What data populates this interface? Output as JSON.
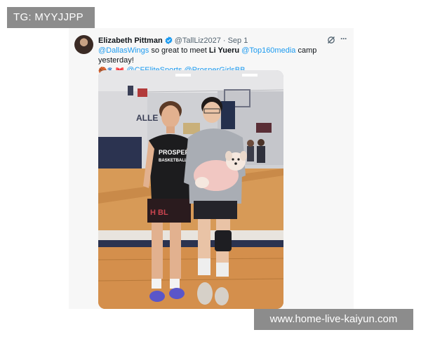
{
  "watermarks": {
    "top": "TG: MYYJJPP",
    "bottom": "www.home-live-kaiyun.com"
  },
  "tweet": {
    "author_name": "Elizabeth Pittman",
    "handle": "@TallLiz2027",
    "separator": "·",
    "date": "Sep 1",
    "line1": [
      {
        "text": "@DallasWings",
        "style": "mention"
      },
      {
        "text": " so great to meet ",
        "style": "plain"
      },
      {
        "text": "Li Yueru",
        "style": "bold"
      },
      {
        "text": " ",
        "style": "plain"
      },
      {
        "text": "@Top160media",
        "style": "mention"
      },
      {
        "text": " camp yesterday!",
        "style": "plain"
      }
    ],
    "line2_emojis": [
      "🏀",
      "🐾",
      "🎀"
    ],
    "line2": [
      {
        "text": "@CFEliteSports",
        "style": "mention"
      },
      {
        "text": " ",
        "style": "plain"
      },
      {
        "text": "@ProsperGirlsBB",
        "style": "mention"
      }
    ],
    "photo_text": {
      "shirt": "PROSPER",
      "shirt_sub": "BASKETBALL",
      "shorts": "H BL",
      "wall_logo": "ALLE"
    }
  },
  "colors": {
    "mention": "#1d9bf0",
    "verified": "#1d9bf0",
    "watermark_bg": "#8c8c8c"
  },
  "icons": [
    "verified-badge-icon",
    "grok-icon",
    "more-options-icon"
  ]
}
